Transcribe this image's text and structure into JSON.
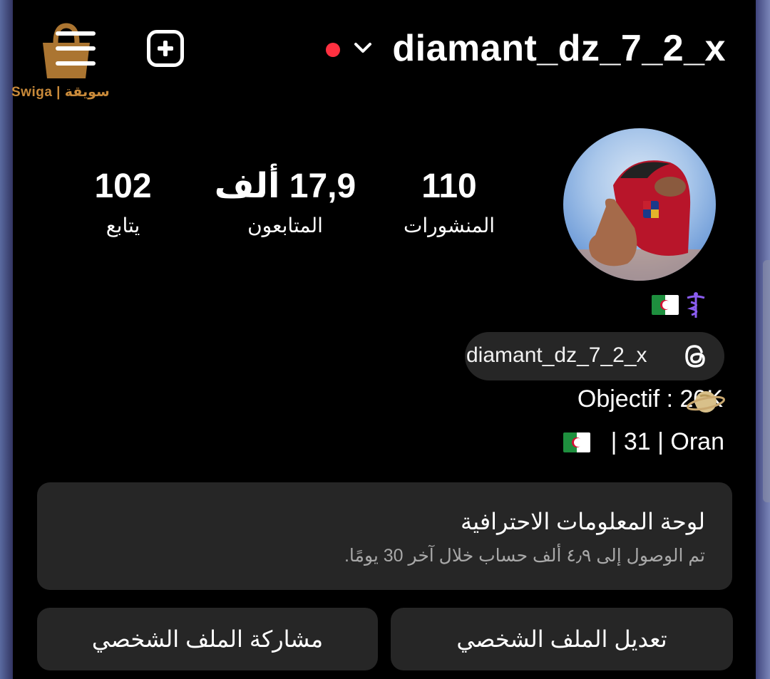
{
  "header": {
    "username": "diamant_dz_7_2_x",
    "watermark": "Swiga | سويقة"
  },
  "stats": {
    "posts": {
      "value": "110",
      "label": "المنشورات"
    },
    "followers": {
      "value": "17,9 ألف",
      "label": "المتابعون"
    },
    "following": {
      "value": "102",
      "label": "يتابع"
    }
  },
  "profile": {
    "threads_handle": "diamant_dz_7_2_x",
    "bio_line_1": "Objectif : 20K",
    "bio_line_2": "| 31 | Oran"
  },
  "dashboard": {
    "title": "لوحة المعلومات الاحترافية",
    "subtitle": "تم الوصول إلى ٤٫٩ ألف حساب خلال آخر 30 يومًا."
  },
  "buttons": {
    "edit_profile": "تعديل الملف الشخصي",
    "share_profile": "مشاركة الملف الشخصي"
  },
  "icons": {
    "menu": "menu-icon",
    "create": "add-icon",
    "live": "live-dot",
    "account_switch": "chevron-down-icon",
    "threads": "threads-icon"
  },
  "colors": {
    "background": "#000000",
    "card": "#262626",
    "live_dot": "#ff3040",
    "subtext": "#a8a8a8"
  }
}
